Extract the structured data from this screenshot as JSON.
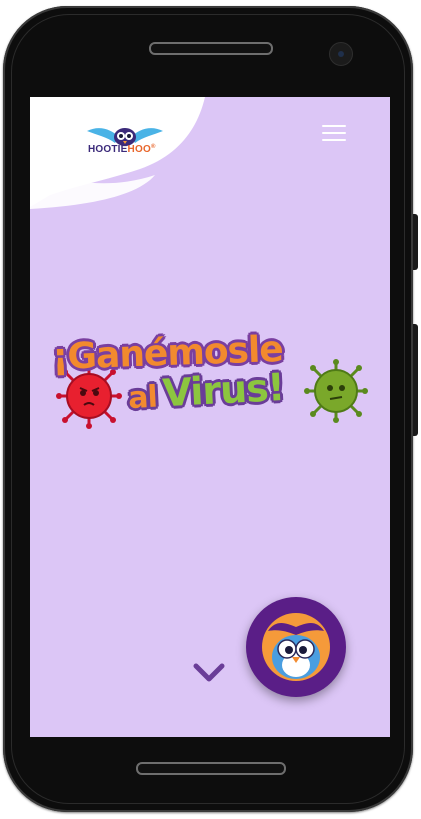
{
  "device": {
    "frame_color": "#0d0d0d",
    "screen_bg": "#dcc6f6"
  },
  "header": {
    "brand": {
      "part1": "HOOTIE",
      "part2": "HOO",
      "registered": "®",
      "colors": {
        "part1": "#3b2a7a",
        "part2": "#e8662b",
        "wings": "#4ab3e6"
      }
    },
    "menu_icon": "hamburger-icon"
  },
  "hero": {
    "title_line1": "¡Ganémosle",
    "title_line2_prefix": "al",
    "title_line2_main": "Virus!",
    "colors": {
      "orange": "#f28a2e",
      "green": "#8cc63f",
      "outline": "#7a3fa0"
    },
    "decorations": [
      "red-virus-icon",
      "green-virus-icon"
    ]
  },
  "scroll_hint": {
    "icon": "chevron-down-icon",
    "color": "#6a3d98"
  },
  "fab": {
    "icon": "owl-mascot-icon",
    "bg": "#5a1e87",
    "inner": "#f59a3a"
  }
}
